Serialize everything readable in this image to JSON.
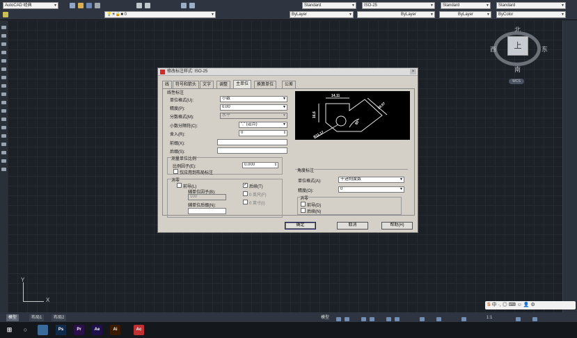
{
  "toolbar": {
    "workspace": "AutoCAD 经典",
    "layer_current": "0",
    "text_style": "Standard",
    "dim_style": "ISO-25",
    "table_style": "Standard",
    "multileader_style": "Standard",
    "color": "ByLayer",
    "linetype": "ByLayer",
    "lineweight": "ByLayer",
    "plot_style": "ByColor"
  },
  "viewcube": {
    "north": "北",
    "south": "南",
    "west": "西",
    "east": "东",
    "face": "上",
    "wcs": "WCS"
  },
  "ucs": {
    "x": "X",
    "y": "Y"
  },
  "layout_tabs": [
    "模型",
    "布局1",
    "布局2"
  ],
  "status": {
    "model": "模型",
    "scale": "1:1"
  },
  "ime": "中 ·, ◎ ⌨ ☺ 👤 ⚙",
  "taskbar_apps": [
    {
      "label": "Ps",
      "color": "#0f2a4a"
    },
    {
      "label": "Pr",
      "color": "#2a0f4a"
    },
    {
      "label": "Ae",
      "color": "#1f0f4a"
    },
    {
      "label": "Ai",
      "color": "#3a1a00"
    },
    {
      "label": "Ac",
      "color": "#c03030"
    }
  ],
  "dialog": {
    "title": "修改标注样式: ISO-25",
    "close": "×",
    "tabs": [
      "线",
      "符号和箭头",
      "文字",
      "调整",
      "主单位",
      "换算单位",
      "公差"
    ],
    "active_tab": "主单位",
    "linear": {
      "heading": "线性标注",
      "unit_format_label": "单位格式(U):",
      "unit_format_value": "小数",
      "precision_label": "精度(P):",
      "precision_value": "0.00",
      "fraction_format_label": "分数格式(M):",
      "fraction_format_value": "水平",
      "decimal_separator_label": "小数分隔符(C):",
      "decimal_separator_value": "\",\" (逗点)",
      "round_off_label": "舍入(R):",
      "round_off_value": "0",
      "prefix_label": "前缀(X):",
      "suffix_label": "后缀(S):"
    },
    "scale": {
      "heading": "测量单位比例",
      "factor_label": "比例因子(E):",
      "factor_value": "0.000",
      "layout_only_label": "仅应用到布局标注"
    },
    "zero_suppress_linear": {
      "heading": "消零",
      "leading_label": "前导(L)",
      "trailing_label": "后续(T)",
      "sub_unit_factor_label": "辅单位因子(B):",
      "sub_unit_factor_value": "100",
      "sub_unit_suffix_label": "辅单位后缀(N):",
      "feet_label": "0 英尺(F)",
      "inches_label": "0 英寸(I)"
    },
    "angular": {
      "heading": "角度标注",
      "unit_format_label": "单位格式(A):",
      "unit_format_value": "十进制度数",
      "precision_label": "精度(O):",
      "precision_value": "0",
      "zero_heading": "消零",
      "leading_label": "前导(D)",
      "trailing_label": "后续(N)"
    },
    "preview_labels": {
      "top": "14,11",
      "left": "16,6",
      "right": "28,07",
      "angle": "80°",
      "radius": "R11,17"
    },
    "buttons": {
      "ok": "确定",
      "cancel": "取消",
      "help": "帮助(H)"
    }
  }
}
